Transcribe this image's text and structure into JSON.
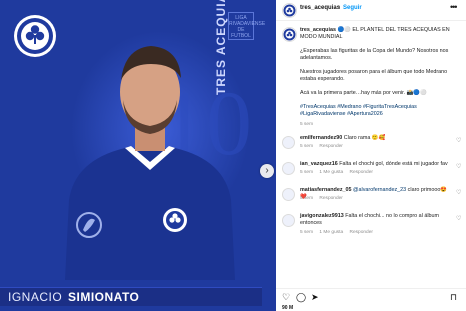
{
  "post": {
    "vertical_name": "TRES ACEQUIAS",
    "big_number": "10",
    "player_first": "IGNACIO",
    "player_last": "SIMIONATO",
    "league_logo_text": "LIGA RIVADAVIENSE DE FUTBOL",
    "colors": {
      "bg": "#1f3a9e",
      "accent": "#3b5cd6",
      "shirt": "#1b3391"
    }
  },
  "header": {
    "username": "tres_acequias",
    "separator": "•",
    "follow_label": "Seguir",
    "more_icon": "more-horizontal-icon"
  },
  "caption": {
    "username": "tres_acequias",
    "emojis_after_user": "🔵⚪",
    "line1": "EL PLANTEL DEL TRES ACEQUIAS EN MODO MUNDIAL",
    "p2": "¿Esperabas las figuritas de la Copa del Mundo? Nosotros nos adelantamos.",
    "p3": "Nuestros jugadores posaron para el álbum que todo Medrano estaba esperando.",
    "p4": "Acá va la primera parte…hay más por venir. 📸🔵⚪",
    "hashtags": [
      "#TresAcequias",
      "#Medrano",
      "#FiguritaTresAcequias",
      "#LigaRivadaviense",
      "#Apertura2026"
    ],
    "time": "5 sem"
  },
  "comments": [
    {
      "user": "emilfernandez90",
      "mention": "",
      "text": "Claro rama 🙂🥰",
      "time": "5 sem",
      "likes": "",
      "reply_label": "Responder"
    },
    {
      "user": "ian_vazquez16",
      "mention": "",
      "text": "Falta el chochi gol, dónde está mi jugador fav",
      "time": "5 sem",
      "likes": "1 Me gusta",
      "reply_label": "Responder"
    },
    {
      "user": "matiasfernandez_05",
      "mention": "@alvarofernandez_23",
      "text": "claro primooo😍❤️",
      "time": "5 sem",
      "likes": "",
      "reply_label": "Responder"
    },
    {
      "user": "javigonzalez9913",
      "mention": "",
      "text": "Falta el chochi... no lo compro al álbum entonces",
      "time": "5 sem",
      "likes": "1 Me gusta",
      "reply_label": "Responder"
    }
  ],
  "actions": {
    "like_icon": "heart-icon",
    "comment_icon": "comment-icon",
    "share_icon": "share-icon",
    "save_icon": "bookmark-icon"
  },
  "likes_hint": "90 M"
}
